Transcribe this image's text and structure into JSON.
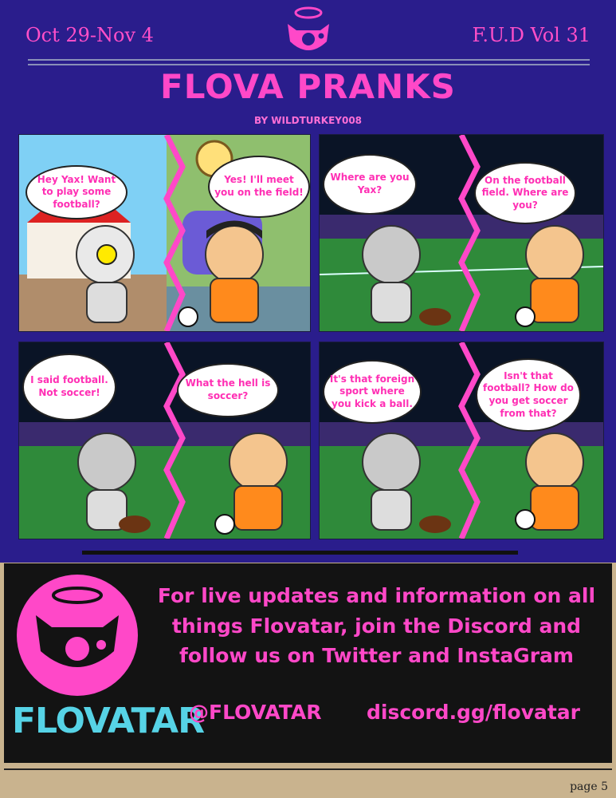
{
  "header": {
    "date_range": "Oct 29-Nov 4",
    "volume": "F.U.D Vol 31"
  },
  "comic": {
    "title": "FLOVA PRANKS",
    "byline": "BY WILDTURKEY008",
    "panels": [
      {
        "left_bubble": "Hey Yax! Want to play some football?",
        "right_bubble": "Yes! I'll meet you on the field!"
      },
      {
        "left_bubble": "Where are you Yax?",
        "right_bubble": "On the football field. Where are you?"
      },
      {
        "left_bubble": "I said football. Not soccer!",
        "right_bubble": "What the hell is soccer?"
      },
      {
        "left_bubble": "It's that foreign sport where you kick a ball.",
        "right_bubble": "Isn't that football? How do you get soccer from that?"
      }
    ]
  },
  "footer": {
    "promo": "For live updates and information on all things Flovatar, join the Discord and follow us on Twitter and InstaGram",
    "twitter_handle": "@FLOVATAR",
    "discord_link": "discord.gg/flovatar",
    "brand": "FLOVATAR",
    "page_number": "page 5"
  },
  "colors": {
    "primary": "#ff48c8",
    "background": "#2a1d8c",
    "brand_text": "#56d3e6"
  }
}
